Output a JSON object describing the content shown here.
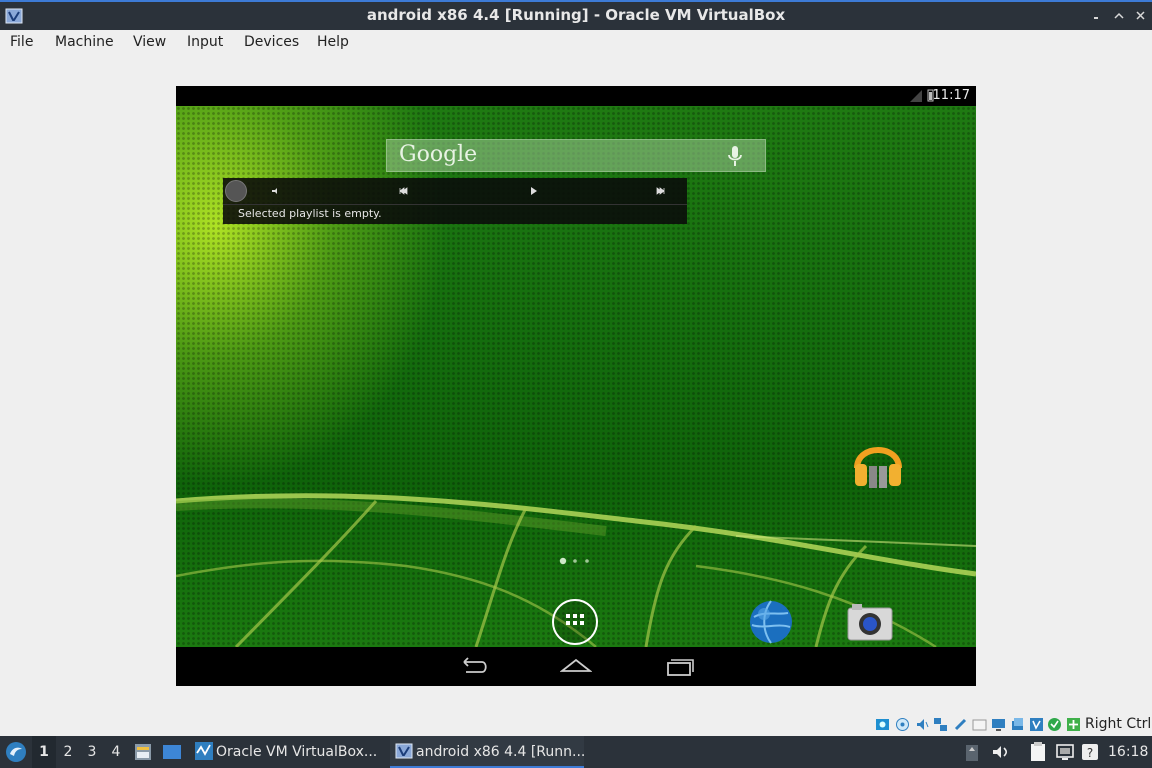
{
  "window": {
    "title": "android x86 4.4 [Running] - Oracle VM VirtualBox"
  },
  "menubar": {
    "items": [
      "File",
      "Machine",
      "View",
      "Input",
      "Devices",
      "Help"
    ]
  },
  "android": {
    "status_time": "11:17",
    "search": {
      "logo": "Google"
    },
    "music_widget": {
      "message": "Selected playlist is empty."
    }
  },
  "vbox_status": {
    "host_key": "Right Ctrl"
  },
  "taskbar": {
    "workspaces": [
      "1",
      "2",
      "3",
      "4"
    ],
    "active_workspace": "1",
    "tasks": [
      {
        "label": "Oracle VM VirtualBox..."
      },
      {
        "label": "android x86 4.4 [Runn..."
      }
    ],
    "clock": "16:18"
  },
  "colors": {
    "accent": "#3d7bd6",
    "titlebar": "#2b323a",
    "wallpaper": "#1a7410"
  }
}
